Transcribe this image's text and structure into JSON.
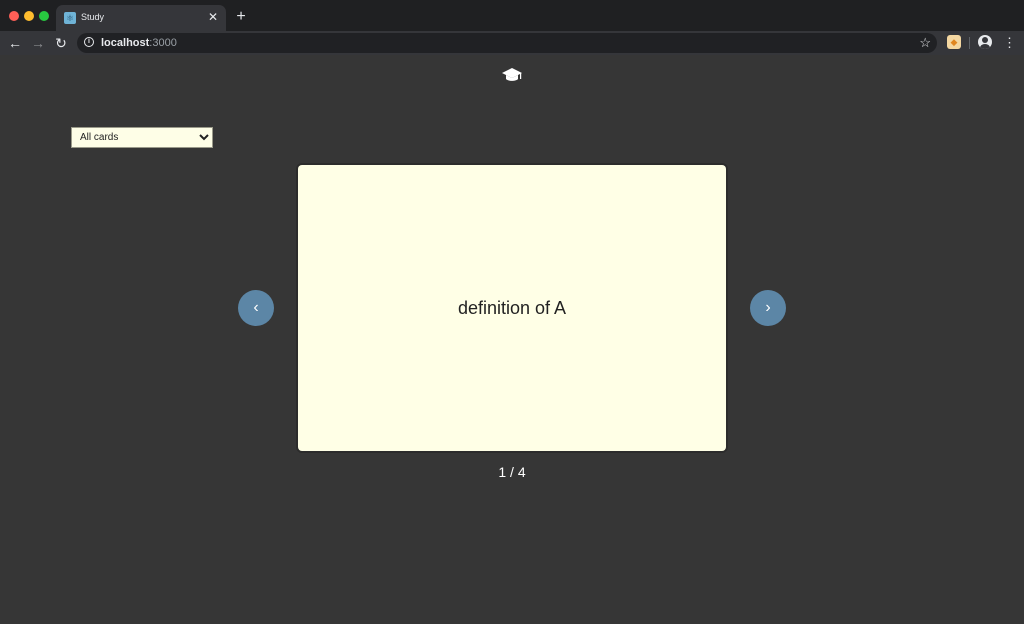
{
  "browser": {
    "tab": {
      "title": "Study",
      "favicon": "react-icon",
      "close_glyph": "✕"
    },
    "new_tab_glyph": "+",
    "nav": {
      "back_glyph": "←",
      "forward_glyph": "→",
      "reload_glyph": "↻"
    },
    "address": {
      "host": "localhost",
      "port": ":3000"
    },
    "star_glyph": "☆",
    "menu_glyph": "⋮"
  },
  "app": {
    "logo_icon": "graduation-cap-icon",
    "deck_select": {
      "selected": "All cards",
      "options": [
        "All cards"
      ]
    },
    "card": {
      "text": "definition of A"
    },
    "prev_glyph": "‹",
    "next_glyph": "›",
    "counter": "1 / 4",
    "colors": {
      "background": "#363636",
      "card": "#ffffe6",
      "arrow_button": "#5c86a6"
    }
  }
}
